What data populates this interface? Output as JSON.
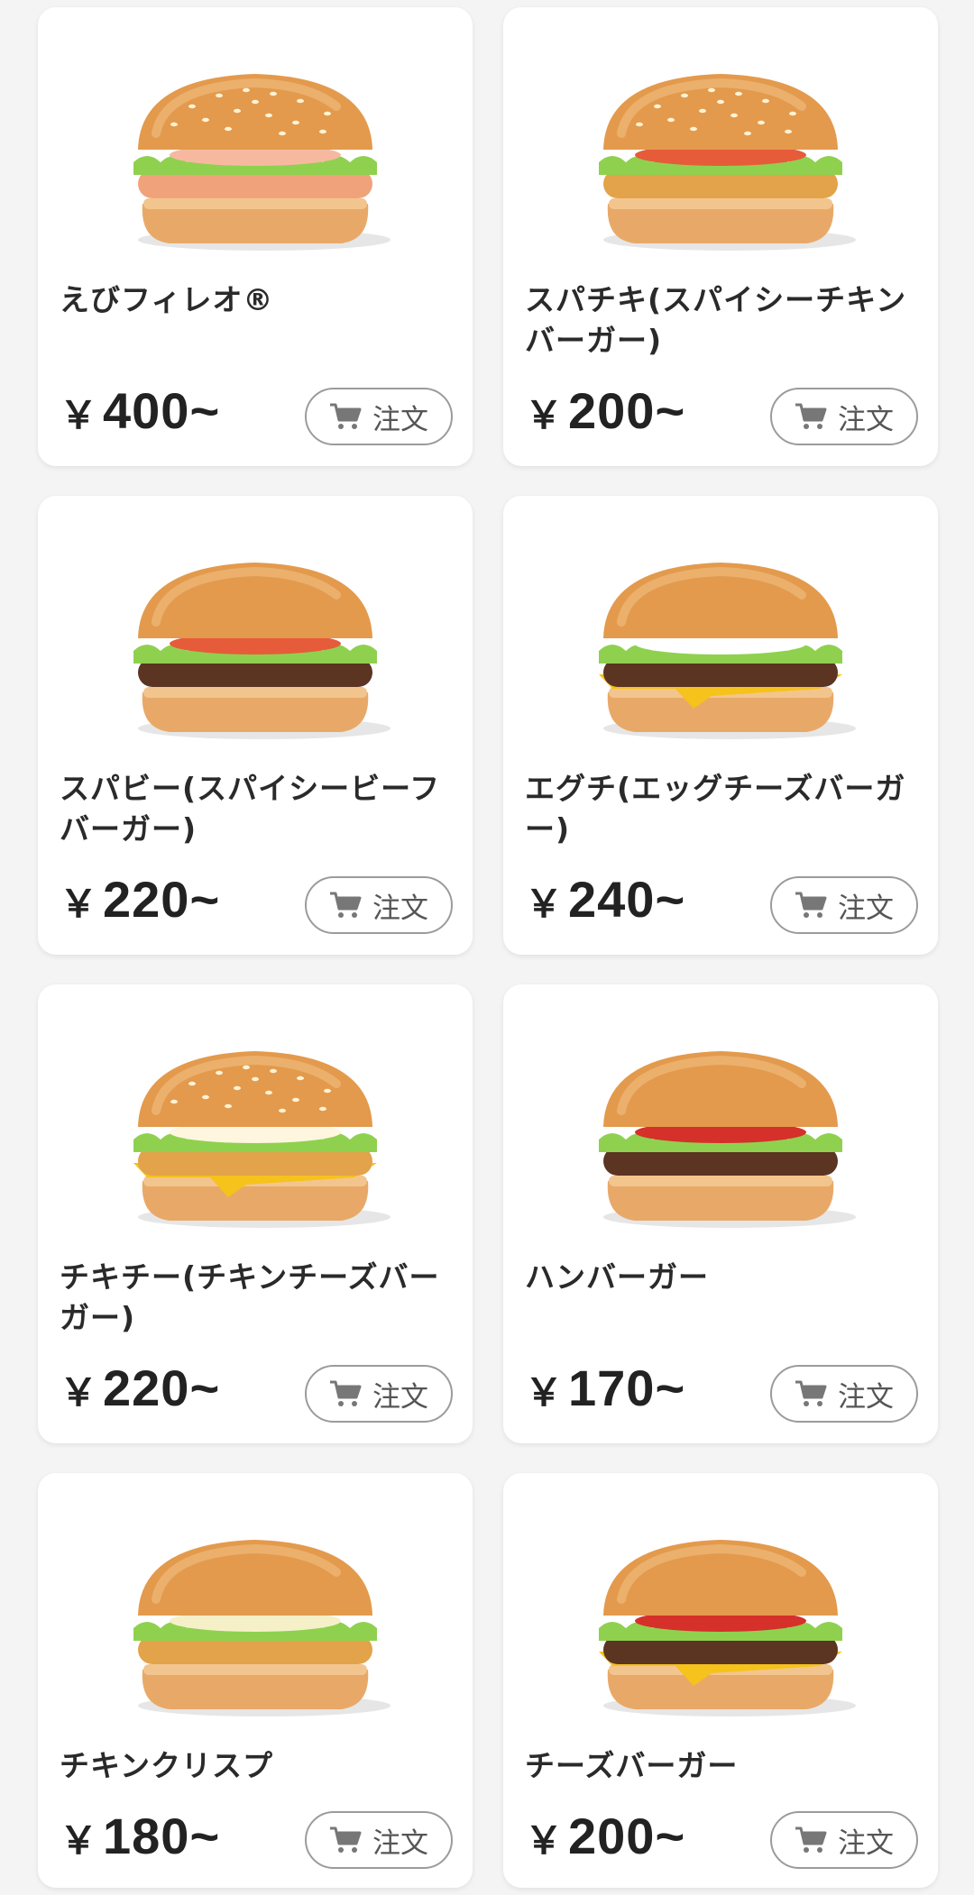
{
  "order_label": "注文",
  "currency": "￥",
  "items": [
    {
      "name": "えびフィレオ®",
      "price": "400~",
      "icon": "ebi-filet-burger",
      "patty": "#f0a37a",
      "cheese": false,
      "sesame": true,
      "sauce": "#f6b9a0"
    },
    {
      "name": "スパチキ(スパイシーチキンバーガー)",
      "price": "200~",
      "icon": "spicy-chicken-burger",
      "patty": "#e3a34a",
      "cheese": false,
      "sesame": true,
      "sauce": "#e65b3a"
    },
    {
      "name": "スパビー(スパイシービーフバーガー)",
      "price": "220~",
      "icon": "spicy-beef-burger",
      "patty": "#5b3422",
      "cheese": false,
      "sesame": false,
      "sauce": "#e65b3a"
    },
    {
      "name": "エグチ(エッグチーズバーガー)",
      "price": "240~",
      "icon": "egg-cheese-burger",
      "patty": "#5b3422",
      "cheese": true,
      "sesame": false,
      "sauce": "#ffffff"
    },
    {
      "name": "チキチー(チキンチーズバーガー)",
      "price": "220~",
      "icon": "chicken-cheese-burger",
      "patty": "#e3a34a",
      "cheese": true,
      "sesame": true,
      "sauce": "#fff6e0"
    },
    {
      "name": "ハンバーガー",
      "price": "170~",
      "icon": "hamburger",
      "patty": "#5b3422",
      "cheese": false,
      "sesame": false,
      "sauce": "#d6302a"
    },
    {
      "name": "チキンクリスプ",
      "price": "180~",
      "icon": "chicken-crisp-burger",
      "patty": "#e3a34a",
      "cheese": false,
      "sesame": false,
      "sauce": "#f6f0c8"
    },
    {
      "name": "チーズバーガー",
      "price": "200~",
      "icon": "cheeseburger",
      "patty": "#5b3422",
      "cheese": true,
      "sesame": false,
      "sauce": "#d6302a"
    }
  ]
}
